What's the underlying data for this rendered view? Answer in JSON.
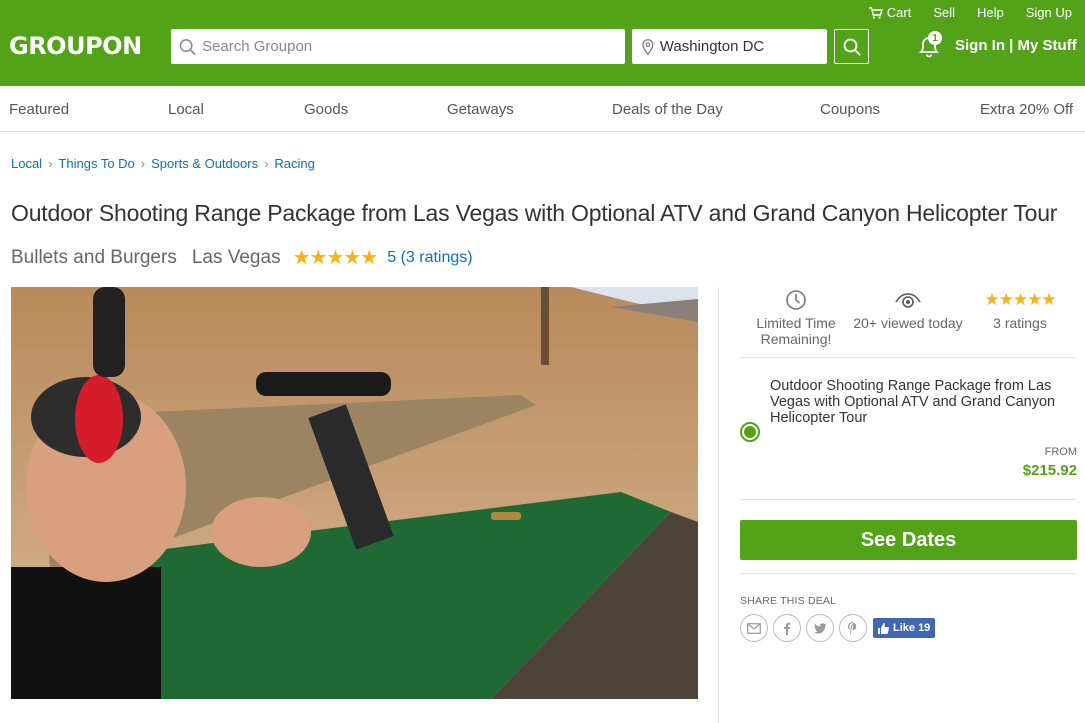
{
  "header": {
    "logo": "GROUPON",
    "top_links": {
      "cart": "Cart",
      "sell": "Sell",
      "help": "Help",
      "signup": "Sign Up"
    },
    "search_placeholder": "Search Groupon",
    "location_value": "Washington DC",
    "notification_count": "1",
    "sign_in": "Sign In | My Stuff",
    "brand_color": "#53a318"
  },
  "nav": {
    "items": [
      "Featured",
      "Local",
      "Goods",
      "Getaways",
      "Deals of the Day",
      "Coupons",
      "Extra 20% Off"
    ]
  },
  "breadcrumb": [
    "Local",
    "Things To Do",
    "Sports & Outdoors",
    "Racing"
  ],
  "deal": {
    "title": "Outdoor Shooting Range Package from Las Vegas with Optional ATV and Grand Canyon Helicopter Tour",
    "merchant": "Bullets and Burgers",
    "city": "Las Vegas",
    "stars": "★★★★★",
    "rating_text": "5 (3 ratings)"
  },
  "stats": {
    "limited": "Limited Time Remaining!",
    "viewed": "20+ viewed today",
    "ratings": "3 ratings",
    "stars": "★★★★★"
  },
  "option": {
    "title": "Outdoor Shooting Range Package from Las Vegas with Optional ATV and Grand Canyon Helicopter Tour",
    "from_label": "FROM",
    "price": "$215.92"
  },
  "cta": {
    "label": "See Dates"
  },
  "share": {
    "label": "SHARE THIS DEAL",
    "like_label": "Like 19"
  }
}
